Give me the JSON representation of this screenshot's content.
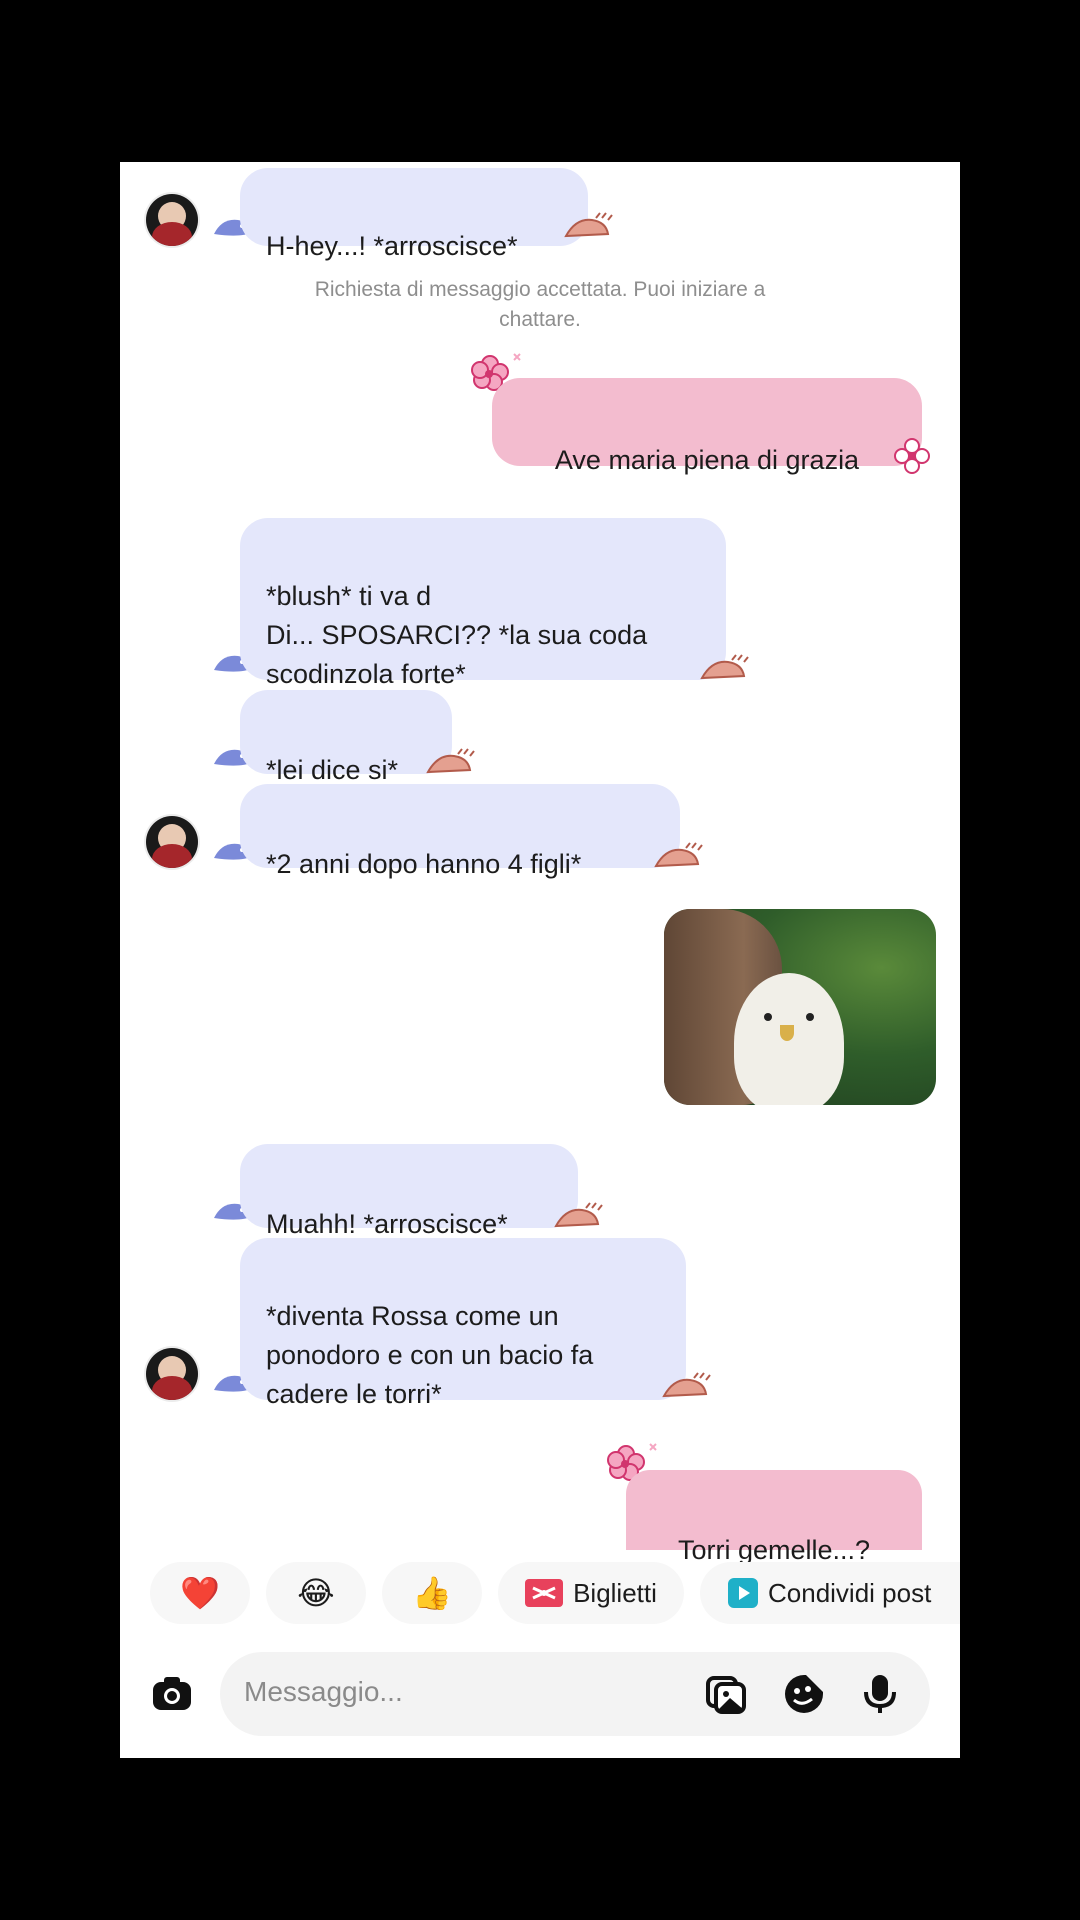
{
  "messages": [
    {
      "dir": "in",
      "text": "H-hey...! *arroscisce*"
    },
    {
      "dir": "out",
      "text": "Ave maria piena di grazia"
    },
    {
      "dir": "in",
      "text": "*blush* ti va d\nDi... SPOSARCI?? *la sua coda\nscodinzola forte*"
    },
    {
      "dir": "in",
      "text": "*lei dice si*"
    },
    {
      "dir": "in",
      "text": "*2 anni dopo hanno 4 figli*"
    },
    {
      "dir": "out",
      "type": "image",
      "subject": "man facing a white eagle"
    },
    {
      "dir": "in",
      "text": "Muahh! *arroscisce*"
    },
    {
      "dir": "in",
      "text": "*diventa Rossa come un\nponodoro e con un bacio fa\ncadere le torri*"
    },
    {
      "dir": "out",
      "text": "Torri gemelle...?"
    }
  ],
  "system_message": "Richiesta di messaggio accettata. Puoi iniziare a\nchattare.",
  "quick_replies": [
    {
      "emoji": "❤️",
      "icon": "heart-icon"
    },
    {
      "emoji": "😂",
      "icon": "laughing-emoji-icon"
    },
    {
      "emoji": "👍",
      "icon": "thumbs-up-icon"
    },
    {
      "label": "Biglietti",
      "icon": "ticket-icon",
      "icon_color": "#e8415c"
    },
    {
      "label": "Condividi post",
      "icon": "play-icon",
      "icon_color": "#1fb0c8"
    }
  ],
  "composer": {
    "placeholder": "Messaggio...",
    "icons": [
      "camera-icon",
      "gallery-icon",
      "sticker-icon",
      "microphone-icon"
    ]
  },
  "colors": {
    "incoming_bubble": "#e4e7fb",
    "outgoing_bubble": "#f3bccf",
    "frame": "#000000",
    "system_text": "#8e8e8e"
  }
}
